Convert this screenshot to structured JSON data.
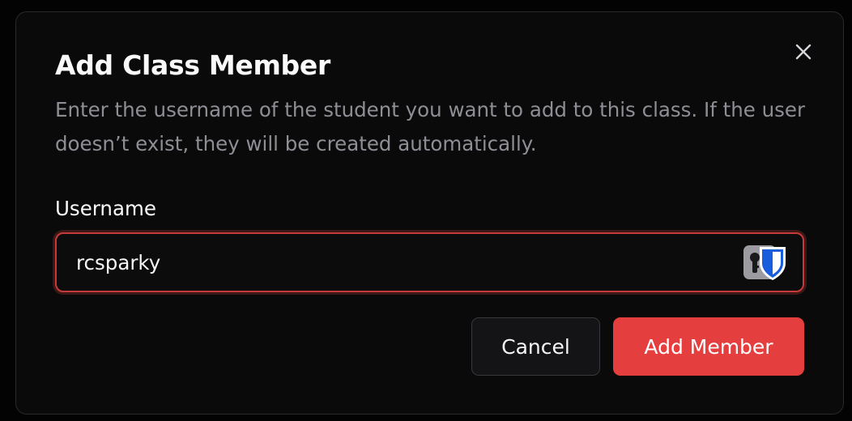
{
  "dialog": {
    "title": "Add Class Member",
    "description": "Enter the username of the student you want to add to this class. If the user doesn’t exist, they will be created automatically.",
    "close_icon": "close-icon"
  },
  "form": {
    "username_label": "Username",
    "username_value": "rcsparky",
    "password_manager_icon": "password-manager-shield-icon"
  },
  "actions": {
    "cancel_label": "Cancel",
    "submit_label": "Add Member"
  },
  "colors": {
    "background": "#0a0a0b",
    "accent": "#e53e3e",
    "input_error_border": "#c73a3a",
    "muted_text": "#8e8e95",
    "password_manager_blue": "#175ddc"
  }
}
